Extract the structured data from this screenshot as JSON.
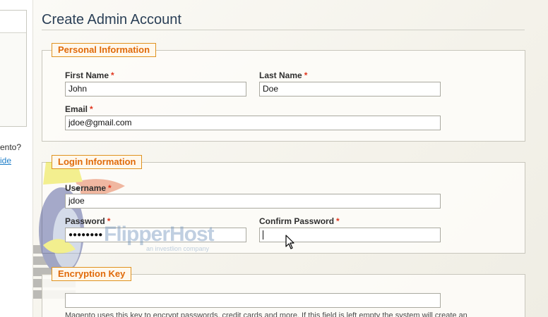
{
  "sidebar": {
    "question_text": "ento?",
    "link_text": "ide"
  },
  "page": {
    "title": "Create Admin Account"
  },
  "personal": {
    "legend": "Personal Information",
    "first_name": {
      "label": "First Name",
      "required": "*",
      "value": "John"
    },
    "last_name": {
      "label": "Last Name",
      "required": "*",
      "value": "Doe"
    },
    "email": {
      "label": "Email",
      "required": "*",
      "value": "jdoe@gmail.com"
    }
  },
  "login": {
    "legend": "Login Information",
    "username": {
      "label": "Username",
      "required": "*",
      "value": "jdoe"
    },
    "password": {
      "label": "Password",
      "required": "*",
      "value": "●●●●●●●●"
    },
    "confirm_password": {
      "label": "Confirm Password",
      "required": "*",
      "value": ""
    }
  },
  "encryption": {
    "legend": "Encryption Key",
    "key_value": "",
    "note": "Magento uses this key to encrypt passwords, credit cards and more. If this field is left empty the system will create an"
  },
  "watermark": {
    "brand": "FlipperHost",
    "tagline": "an investlion company"
  },
  "colors": {
    "legend_text": "#e06a0a",
    "legend_border": "#e0921f",
    "required_star": "#e0351d",
    "title": "#2a3f56",
    "link": "#1e7ec8"
  }
}
